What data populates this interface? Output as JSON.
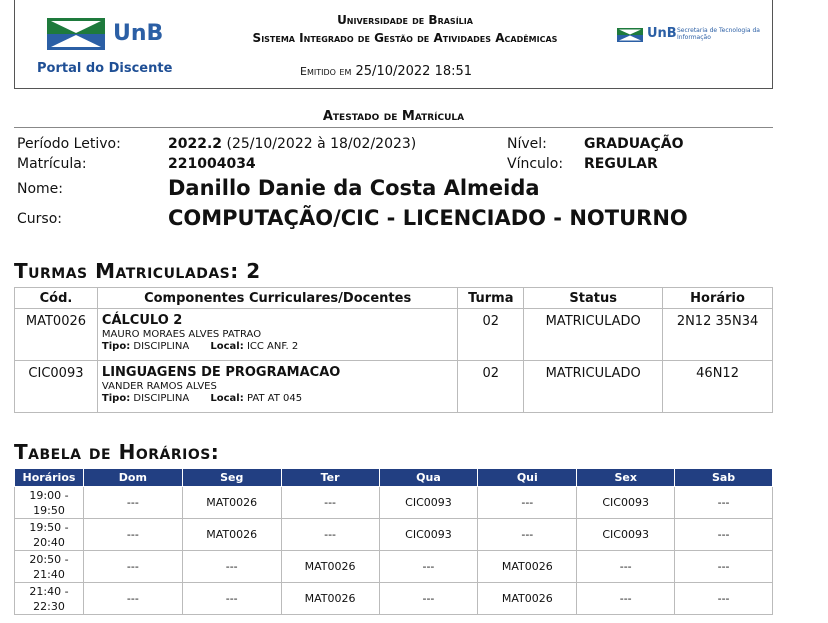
{
  "header": {
    "logo_text": "UnB",
    "portal": "Portal do Discente",
    "university": "Universidade de Brasília",
    "system": "Sistema Integrado de Gestão de Atividades Acadêmicas",
    "emitido_label": "Emitido em",
    "emitido_value": "25/10/2022 18:51",
    "stic_logo_text": "UnB",
    "stic_logo_sub": "Secretaria de Tecnologia da Informação"
  },
  "atestado": {
    "title": "Atestado de Matrícula",
    "periodo_label": "Período Letivo:",
    "periodo_value": "2022.2",
    "periodo_range": "(25/10/2022 à 18/02/2023)",
    "matricula_label": "Matrícula:",
    "matricula_value": "221004034",
    "nivel_label": "Nível:",
    "nivel_value": "GRADUAÇÃO",
    "vinculo_label": "Vínculo:",
    "vinculo_value": "REGULAR",
    "nome_label": "Nome:",
    "nome_value": "Danillo Danie da Costa Almeida",
    "curso_label": "Curso:",
    "curso_value": "COMPUTAÇÃO/CIC - LICENCIADO - NOTURNO"
  },
  "turmas": {
    "title": "Turmas Matriculadas: 2",
    "headers": [
      "Cód.",
      "Componentes Curriculares/Docentes",
      "Turma",
      "Status",
      "Horário"
    ],
    "tipo_label": "Tipo:",
    "local_label": "Local:",
    "rows": [
      {
        "cod": "MAT0026",
        "nome": "CÁLCULO 2",
        "docente": "MAURO MORAES ALVES PATRAO",
        "tipo": "DISCIPLINA",
        "local": "ICC ANF. 2",
        "turma": "02",
        "status": "MATRICULADO",
        "horario": "2N12 35N34"
      },
      {
        "cod": "CIC0093",
        "nome": "LINGUAGENS DE PROGRAMACAO",
        "docente": "VANDER RAMOS ALVES",
        "tipo": "DISCIPLINA",
        "local": "PAT AT 045",
        "turma": "02",
        "status": "MATRICULADO",
        "horario": "46N12"
      }
    ]
  },
  "horarios": {
    "title": "Tabela de Horários:",
    "headers": [
      "Horários",
      "Dom",
      "Seg",
      "Ter",
      "Qua",
      "Qui",
      "Sex",
      "Sab"
    ],
    "rows": [
      {
        "h1": "19:00 -",
        "h2": "19:50",
        "cells": [
          "---",
          "MAT0026",
          "---",
          "CIC0093",
          "---",
          "CIC0093",
          "---"
        ]
      },
      {
        "h1": "19:50 -",
        "h2": "20:40",
        "cells": [
          "---",
          "MAT0026",
          "---",
          "CIC0093",
          "---",
          "CIC0093",
          "---"
        ]
      },
      {
        "h1": "20:50 -",
        "h2": "21:40",
        "cells": [
          "---",
          "---",
          "MAT0026",
          "---",
          "MAT0026",
          "---",
          "---"
        ]
      },
      {
        "h1": "21:40 -",
        "h2": "22:30",
        "cells": [
          "---",
          "---",
          "MAT0026",
          "---",
          "MAT0026",
          "---",
          "---"
        ]
      }
    ]
  },
  "colors": {
    "unb_green": "#1e7a3c",
    "unb_blue": "#2b5fa5",
    "table_header": "#223f82"
  }
}
